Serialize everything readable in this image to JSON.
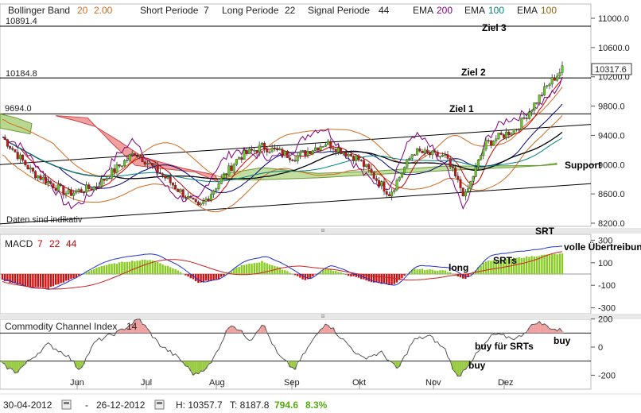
{
  "legend": {
    "bb_label": "Bollinger Band",
    "bb_period": "20",
    "bb_dev": "2.00",
    "short_label": "Short Periode",
    "short_value": "7",
    "long_label": "Long Periode",
    "long_value": "22",
    "signal_label": "Signal Periode",
    "signal_value": "44",
    "ema_label": "EMA",
    "ema1": "200",
    "ema2": "100",
    "ema3": "100"
  },
  "main": {
    "y_ticks": [
      "11000.0",
      "10600.0",
      "10200.0",
      "9800.0",
      "9400.0",
      "9000.0",
      "8600.0",
      "8200.0"
    ],
    "y_values": [
      11000,
      10600,
      10200,
      9800,
      9400,
      9000,
      8600,
      8200
    ],
    "ylim": [
      8200,
      11000
    ],
    "level_labels": [
      "10891.4",
      "10184.8",
      "9694.0"
    ],
    "level_values": [
      10891.4,
      10184.8,
      9694.0
    ],
    "current_price": "10317.6",
    "annotations": [
      "Ziel 3",
      "Ziel 2",
      "Ziel 1",
      "Support"
    ],
    "note": "Daten sind indikativ"
  },
  "macd": {
    "label": "MACD",
    "p1": "7",
    "p2": "22",
    "p3": "44",
    "y_ticks": [
      "300",
      "100",
      "-100",
      "-300"
    ],
    "y_values": [
      300,
      100,
      -100,
      -300
    ],
    "annotations": [
      "SRT",
      "volle Übertreibung",
      "SRTs",
      "long"
    ]
  },
  "cci": {
    "label": "Commodity Channel Index",
    "period": "14",
    "y_ticks": [
      "200",
      "0",
      "-200"
    ],
    "y_values": [
      200,
      0,
      -200
    ],
    "annotations": [
      "buy für SRTs",
      "buy",
      "buy"
    ]
  },
  "x_axis": {
    "months": [
      "Jun",
      "Jul",
      "Aug",
      "Sep",
      "Okt",
      "Nov",
      "Dez"
    ]
  },
  "footer": {
    "start_date": "30-04-2012",
    "sep": "-",
    "end_date": "26-12-2012",
    "high": "H: 10357.7",
    "low": "T: 8187.8",
    "change_abs": "794.6",
    "change_pct": "8.3%"
  },
  "colors": {
    "bb": "#d2691e",
    "short": "#cc0000",
    "long": "#000080",
    "signal": "#800080",
    "ema1": "#800080",
    "ema2": "#008080",
    "ema3": "#996600",
    "macd_up": "#88cc22",
    "macd_down": "#cc1111",
    "macd_line": "#2233cc",
    "signal_line": "#cc2222",
    "cci_pos": "#f0a0a0",
    "cci_neg": "#99cc44"
  },
  "chart_data": {
    "type": "line",
    "title": "",
    "x": [
      "30-04-2012",
      "Jun",
      "Jul",
      "Aug",
      "Sep",
      "Okt",
      "Nov",
      "Dez",
      "26-12-2012"
    ],
    "series": [
      {
        "name": "",
        "values": [
          9390,
          8600,
          9170,
          8400,
          9300,
          9080,
          9180,
          8560,
          10317.6
        ]
      }
    ],
    "high": 10357.7,
    "low": 8187.8,
    "ylim": [
      8200,
      11000
    ],
    "grid": true,
    "legend_position": "top-left"
  }
}
